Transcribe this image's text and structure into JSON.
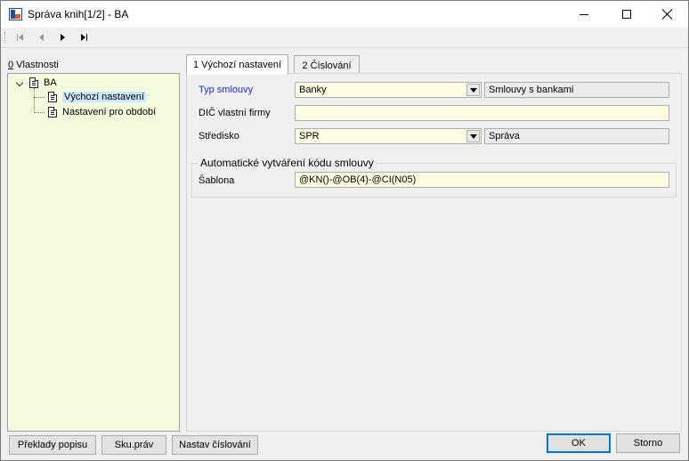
{
  "window": {
    "title": "Správa knih[1/2] - BA",
    "app_icon_label": "K2"
  },
  "toolbar": {
    "first": "first-record",
    "prev": "previous-record",
    "next": "next-record",
    "last": "last-record"
  },
  "left_panel": {
    "label_prefix": "0",
    "label_rest": " Vlastnosti",
    "tree": {
      "root": "BA",
      "children": [
        "Výchozí nastavení",
        "Nastavení pro období"
      ]
    }
  },
  "tabs": [
    {
      "label": "1 Výchozí nastavení",
      "active": true
    },
    {
      "label": "2 Číslování",
      "active": false
    }
  ],
  "form": {
    "typ_smlouvy": {
      "label": "Typ smlouvy",
      "value": "Banky",
      "description": "Smlouvy s bankami"
    },
    "dic": {
      "label": "DIČ vlastní firmy",
      "value": ""
    },
    "stredisko": {
      "label": "Středisko",
      "value": "SPR",
      "description": "Správa"
    },
    "group_title": "Automatické vytváření kódu smlouvy",
    "sablona": {
      "label": "Šablona",
      "value": "@KN()-@OB(4)-@CI(N05)"
    }
  },
  "buttons": {
    "preklady": "Překlady popisu",
    "sku": "Sku.práv",
    "nastav": "Nastav číslování",
    "ok": "OK",
    "storno": "Storno"
  },
  "colors": {
    "tree_bg": "#f4fbdc",
    "input_bg": "#fffde1",
    "accent_label": "#1a2ed6",
    "selection": "#cce8ff"
  }
}
